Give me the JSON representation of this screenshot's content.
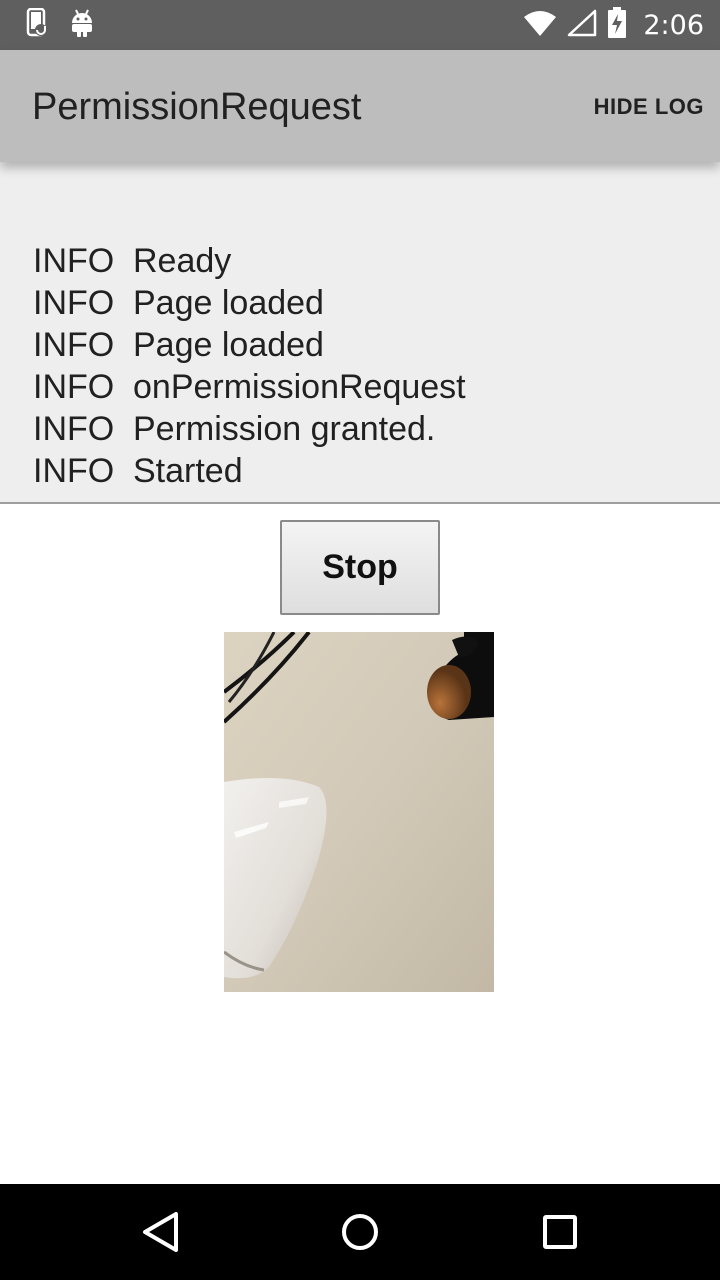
{
  "status_bar": {
    "time": "2:06",
    "icons": [
      "phone-notification-icon",
      "android-icon",
      "wifi-icon",
      "signal-icon",
      "battery-charging-icon"
    ]
  },
  "app_bar": {
    "title": "PermissionRequest",
    "action_label": "HIDE LOG"
  },
  "log": {
    "entries": [
      {
        "level": "INFO",
        "message": "Ready"
      },
      {
        "level": "INFO",
        "message": "Page loaded"
      },
      {
        "level": "INFO",
        "message": "Page loaded"
      },
      {
        "level": "INFO",
        "message": "onPermissionRequest"
      },
      {
        "level": "INFO",
        "message": "Permission granted."
      },
      {
        "level": "INFO",
        "message": "Started"
      }
    ]
  },
  "controls": {
    "stop_label": "Stop"
  },
  "nav_bar": {
    "icons": [
      "back-icon",
      "home-icon",
      "recents-icon"
    ]
  }
}
